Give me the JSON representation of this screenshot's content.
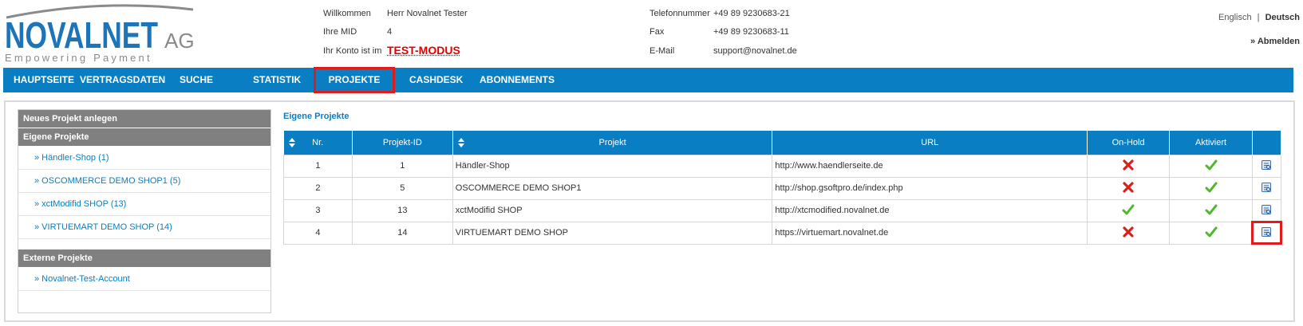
{
  "logo": {
    "name": "NOVALNET",
    "suffix": "AG",
    "tagline": "Empowering Payment"
  },
  "header": {
    "welcome_label": "Willkommen",
    "welcome_value": "Herr Novalnet Tester",
    "mid_label": "Ihre MID",
    "mid_value": "4",
    "account_label": "Ihr Konto ist im",
    "account_mode": "TEST-MODUS",
    "phone_label": "Telefonnummer",
    "phone_value": "+49 89 9230683-21",
    "fax_label": "Fax",
    "fax_value": "+49 89 9230683-11",
    "email_label": "E-Mail",
    "email_value": "support@novalnet.de",
    "lang_en": "Englisch",
    "lang_sep": "|",
    "lang_de": "Deutsch",
    "logout": "» Abmelden"
  },
  "nav": {
    "items": [
      {
        "label": "HAUPTSEITE"
      },
      {
        "label": "VERTRAGSDATEN"
      },
      {
        "label": "SUCHE"
      },
      {
        "label": "STATISTIK"
      },
      {
        "label": "PROJEKTE"
      },
      {
        "label": "CASHDESK"
      },
      {
        "label": "ABONNEMENTS"
      }
    ],
    "active": "PROJEKTE",
    "highlight_color": "#e01b1b",
    "bar_color": "#0a7ec2"
  },
  "sidebar": {
    "new_project": "Neues Projekt anlegen",
    "own_projects_title": "Eigene Projekte",
    "own_projects": [
      {
        "label": "» Händler-Shop (1)"
      },
      {
        "label": "» OSCOMMERCE DEMO SHOP1 (5)"
      },
      {
        "label": "» xctModifid SHOP (13)"
      },
      {
        "label": "» VIRTUEMART DEMO SHOP (14)"
      }
    ],
    "external_title": "Externe Projekte",
    "external_projects": [
      {
        "label": "» Novalnet-Test-Account"
      }
    ]
  },
  "main": {
    "title": "Eigene Projekte",
    "columns": [
      "Nr.",
      "Projekt-ID",
      "Projekt",
      "URL",
      "On-Hold",
      "Aktiviert"
    ],
    "rows": [
      {
        "nr": "1",
        "id": "1",
        "project": "Händler-Shop",
        "url": "http://www.haendlerseite.de",
        "on_hold": "no",
        "activated": "yes"
      },
      {
        "nr": "2",
        "id": "5",
        "project": "OSCOMMERCE DEMO SHOP1",
        "url": "http://shop.gsoftpro.de/index.php",
        "on_hold": "no",
        "activated": "yes"
      },
      {
        "nr": "3",
        "id": "13",
        "project": "xctModifid SHOP",
        "url": "http://xtcmodified.novalnet.de",
        "on_hold": "yes",
        "activated": "yes"
      },
      {
        "nr": "4",
        "id": "14",
        "project": "VIRTUEMART DEMO SHOP",
        "url": "https://virtuemart.novalnet.de",
        "on_hold": "no",
        "activated": "yes"
      }
    ]
  }
}
